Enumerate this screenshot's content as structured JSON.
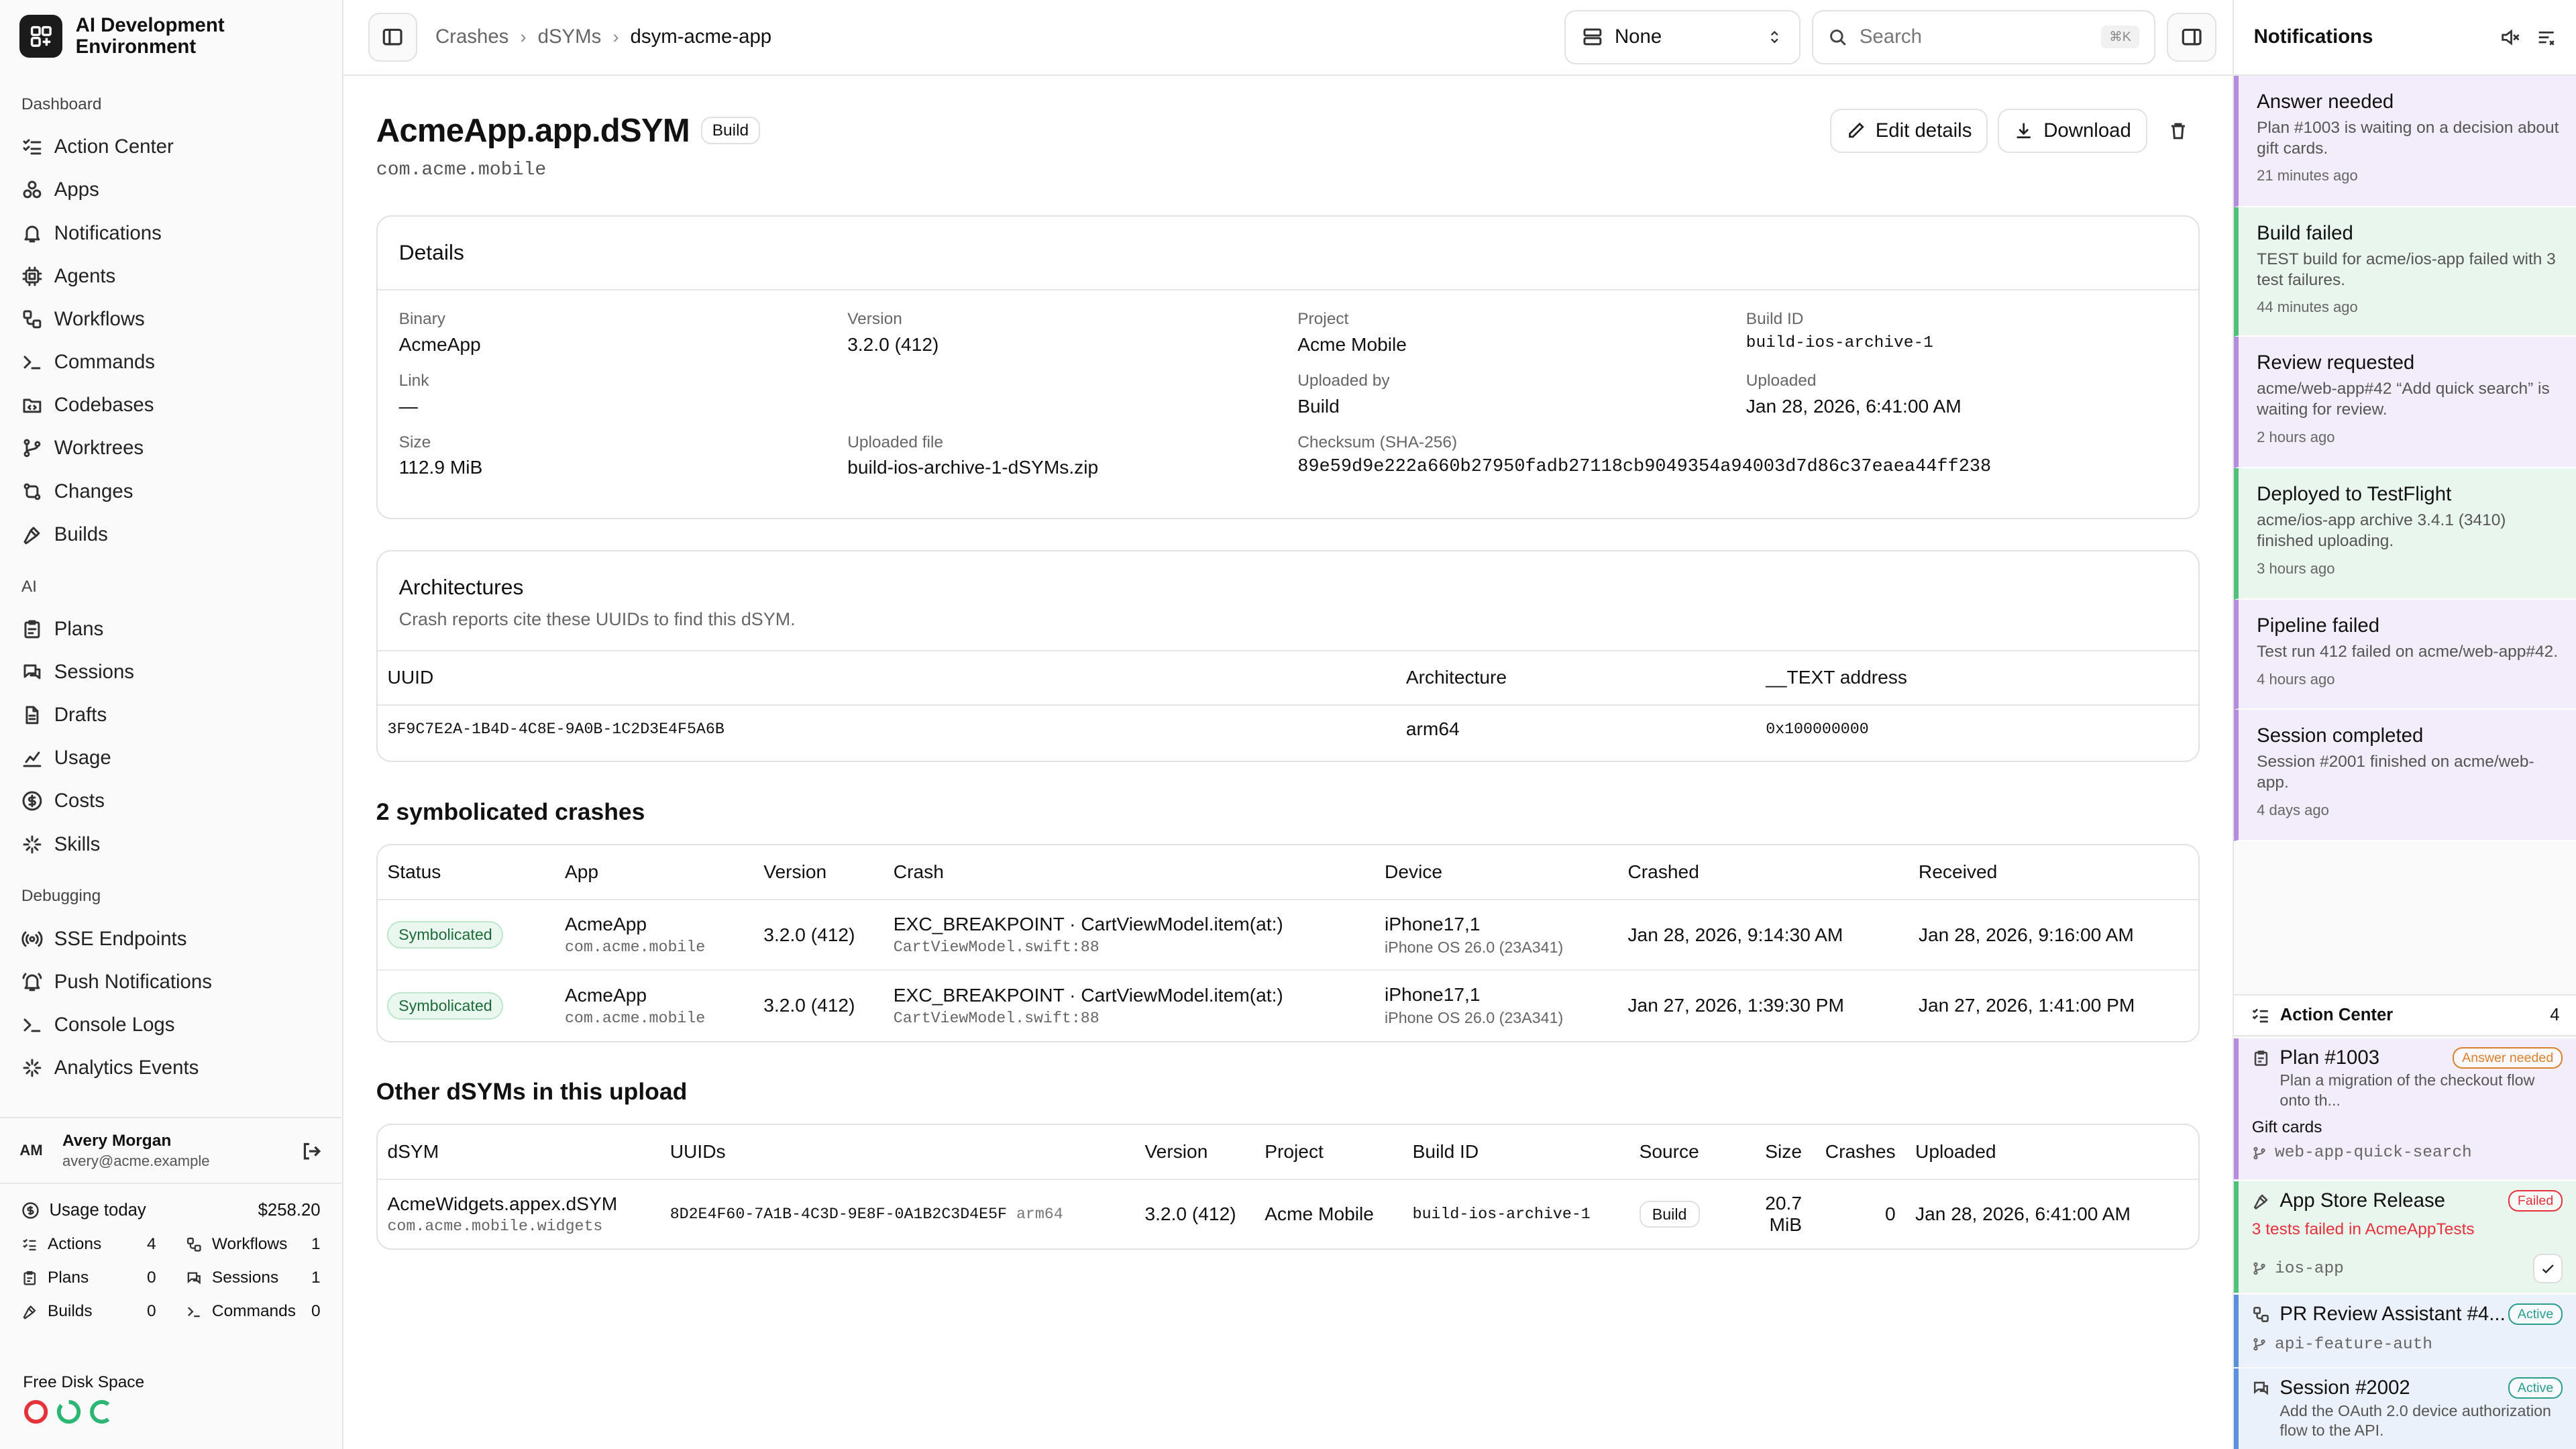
{
  "app": {
    "title": "AI Development Environment"
  },
  "sidebar": {
    "dashboard_label": "Dashboard",
    "dashboard": [
      {
        "label": "Action Center",
        "icon": "list-check-icon"
      },
      {
        "label": "Apps",
        "icon": "apps-icon"
      },
      {
        "label": "Notifications",
        "icon": "bell-icon"
      },
      {
        "label": "Agents",
        "icon": "cpu-icon"
      },
      {
        "label": "Workflows",
        "icon": "workflow-icon"
      },
      {
        "label": "Commands",
        "icon": "terminal-icon"
      },
      {
        "label": "Codebases",
        "icon": "folder-code-icon"
      },
      {
        "label": "Worktrees",
        "icon": "branch-icon"
      },
      {
        "label": "Changes",
        "icon": "diff-icon"
      },
      {
        "label": "Builds",
        "icon": "hammer-icon"
      }
    ],
    "ai_label": "AI",
    "ai": [
      {
        "label": "Plans",
        "icon": "clipboard-icon"
      },
      {
        "label": "Sessions",
        "icon": "chat-icon"
      },
      {
        "label": "Drafts",
        "icon": "file-icon"
      },
      {
        "label": "Usage",
        "icon": "chart-icon"
      },
      {
        "label": "Costs",
        "icon": "dollar-icon"
      },
      {
        "label": "Skills",
        "icon": "sparkle-icon"
      }
    ],
    "debug_label": "Debugging",
    "debugging": [
      {
        "label": "SSE Endpoints",
        "icon": "radio-icon"
      },
      {
        "label": "Push Notifications",
        "icon": "bell-ring-icon"
      },
      {
        "label": "Console Logs",
        "icon": "terminal-icon"
      },
      {
        "label": "Analytics Events",
        "icon": "sparkle-icon"
      }
    ],
    "user": {
      "initials": "AM",
      "name": "Avery Morgan",
      "email": "avery@acme.example"
    },
    "usage": {
      "title": "Usage today",
      "total": "$258.20",
      "stats": [
        {
          "label": "Actions",
          "value": "4"
        },
        {
          "label": "Workflows",
          "value": "1"
        },
        {
          "label": "Plans",
          "value": "0"
        },
        {
          "label": "Sessions",
          "value": "1"
        },
        {
          "label": "Builds",
          "value": "0"
        },
        {
          "label": "Commands",
          "value": "0"
        }
      ]
    },
    "disk": {
      "title": "Free Disk Space",
      "colors": [
        "#e5323b",
        "#2bb673",
        "#2bb673"
      ]
    }
  },
  "topbar": {
    "breadcrumbs": [
      "Crashes",
      "dSYMs",
      "dsym-acme-app"
    ],
    "select_value": "None",
    "search_placeholder": "Search",
    "shortcut": "⌘K"
  },
  "header": {
    "title": "AcmeApp.app.dSYM",
    "badge": "Build",
    "bundle": "com.acme.mobile",
    "edit_label": "Edit details",
    "download_label": "Download"
  },
  "details": {
    "title": "Details",
    "fields": [
      {
        "label": "Binary",
        "value": "AcmeApp"
      },
      {
        "label": "Version",
        "value": "3.2.0 (412)"
      },
      {
        "label": "Project",
        "value": "Acme Mobile"
      },
      {
        "label": "Build ID",
        "value": "build-ios-archive-1",
        "mono": true
      },
      {
        "label": "Link",
        "value": "—"
      },
      {
        "label": "",
        "value": ""
      },
      {
        "label": "Uploaded by",
        "value": "Build"
      },
      {
        "label": "Uploaded",
        "value": "Jan 28, 2026, 6:41:00 AM"
      },
      {
        "label": "Size",
        "value": "112.9 MiB"
      },
      {
        "label": "Uploaded file",
        "value": "build-ios-archive-1-dSYMs.zip"
      },
      {
        "label": "Checksum (SHA-256)",
        "value": "89e59d9e222a660b27950fadb27118cb9049354a94003d7d86c37eaea44ff238"
      },
      {
        "label": "",
        "value": ""
      }
    ]
  },
  "architectures": {
    "title": "Architectures",
    "subtitle": "Crash reports cite these UUIDs to find this dSYM.",
    "columns": [
      "UUID",
      "Architecture",
      "__TEXT address"
    ],
    "rows": [
      {
        "uuid": "3F9C7E2A-1B4D-4C8E-9A0B-1C2D3E4F5A6B",
        "arch": "arm64",
        "address": "0x100000000"
      }
    ]
  },
  "crashes": {
    "title": "2 symbolicated crashes",
    "columns": [
      "Status",
      "App",
      "Version",
      "Crash",
      "Device",
      "Crashed",
      "Received"
    ],
    "rows": [
      {
        "status": "Symbolicated",
        "app": "AcmeApp",
        "bundle": "com.acme.mobile",
        "version": "3.2.0 (412)",
        "crash": "EXC_BREAKPOINT · CartViewModel.item(at:)",
        "file": "CartViewModel.swift:88",
        "device": "iPhone17,1",
        "os": "iPhone OS 26.0 (23A341)",
        "crashed": "Jan 28, 2026, 9:14:30 AM",
        "received": "Jan 28, 2026, 9:16:00 AM"
      },
      {
        "status": "Symbolicated",
        "app": "AcmeApp",
        "bundle": "com.acme.mobile",
        "version": "3.2.0 (412)",
        "crash": "EXC_BREAKPOINT · CartViewModel.item(at:)",
        "file": "CartViewModel.swift:88",
        "device": "iPhone17,1",
        "os": "iPhone OS 26.0 (23A341)",
        "crashed": "Jan 27, 2026, 1:39:30 PM",
        "received": "Jan 27, 2026, 1:41:00 PM"
      }
    ]
  },
  "others": {
    "title": "Other dSYMs in this upload",
    "columns": [
      "dSYM",
      "UUIDs",
      "Version",
      "Project",
      "Build ID",
      "Source",
      "Size",
      "Crashes",
      "Uploaded"
    ],
    "rows": [
      {
        "name": "AcmeWidgets.appex.dSYM",
        "bundle": "com.acme.mobile.widgets",
        "uuid": "8D2E4F60-7A1B-4C3D-9E8F-0A1B2C3D4E5F",
        "arch": "arm64",
        "version": "3.2.0 (412)",
        "project": "Acme Mobile",
        "build_id": "build-ios-archive-1",
        "source": "Build",
        "size": "20.7 MiB",
        "crashes": "0",
        "uploaded": "Jan 28, 2026, 6:41:00 AM"
      }
    ]
  },
  "notifications": {
    "title": "Notifications",
    "items": [
      {
        "title": "Answer needed",
        "body": "Plan #1003 is waiting on a decision about gift cards.",
        "time": "21 minutes ago",
        "color": "#b58ce0",
        "bg": "#f3ecfb"
      },
      {
        "title": "Build failed",
        "body": "TEST build for acme/ios-app failed with 3 test failures.",
        "time": "44 minutes ago",
        "color": "#52c07a",
        "bg": "#e9f6ee"
      },
      {
        "title": "Review requested",
        "body": "acme/web-app#42 “Add quick search” is waiting for review.",
        "time": "2 hours ago",
        "color": "#b58ce0",
        "bg": "#f3ecfb"
      },
      {
        "title": "Deployed to TestFlight",
        "body": "acme/ios-app archive 3.4.1 (3410) finished uploading.",
        "time": "3 hours ago",
        "color": "#52c07a",
        "bg": "#e9f6ee"
      },
      {
        "title": "Pipeline failed",
        "body": "Test run 412 failed on acme/web-app#42.",
        "time": "4 hours ago",
        "color": "#b58ce0",
        "bg": "#f3ecfb"
      },
      {
        "title": "Session completed",
        "body": "Session #2001 finished on acme/web-app.",
        "time": "4 days ago",
        "color": "#b58ce0",
        "bg": "#f3ecfb"
      }
    ]
  },
  "action_center": {
    "title": "Action Center",
    "count": "4",
    "items": [
      {
        "title": "Plan #1003",
        "badge": "Answer needed",
        "desc": "Plan a migration of the checkout flow onto th...",
        "extra": "Gift cards",
        "meta": "web-app-quick-search",
        "color": "#b58ce0",
        "bg": "#f3ecfb",
        "badge_color": "#d9822b"
      },
      {
        "title": "App Store Release",
        "badge": "Failed",
        "desc": "3 tests failed in AcmeAppTests",
        "meta": "ios-app",
        "color": "#52c07a",
        "bg": "#e9f6ee",
        "badge_color": "#e5323b"
      },
      {
        "title": "PR Review Assistant #4...",
        "badge": "Active",
        "meta": "api-feature-auth",
        "color": "#5b8fd9",
        "bg": "#eaf1fb",
        "badge_color": "#2a9d8f"
      },
      {
        "title": "Session #2002",
        "badge": "Active",
        "desc": "Add the OAuth 2.0 device authorization flow to the API.",
        "color": "#5b8fd9",
        "bg": "#eaf1fb",
        "badge_color": "#2a9d8f"
      }
    ]
  }
}
